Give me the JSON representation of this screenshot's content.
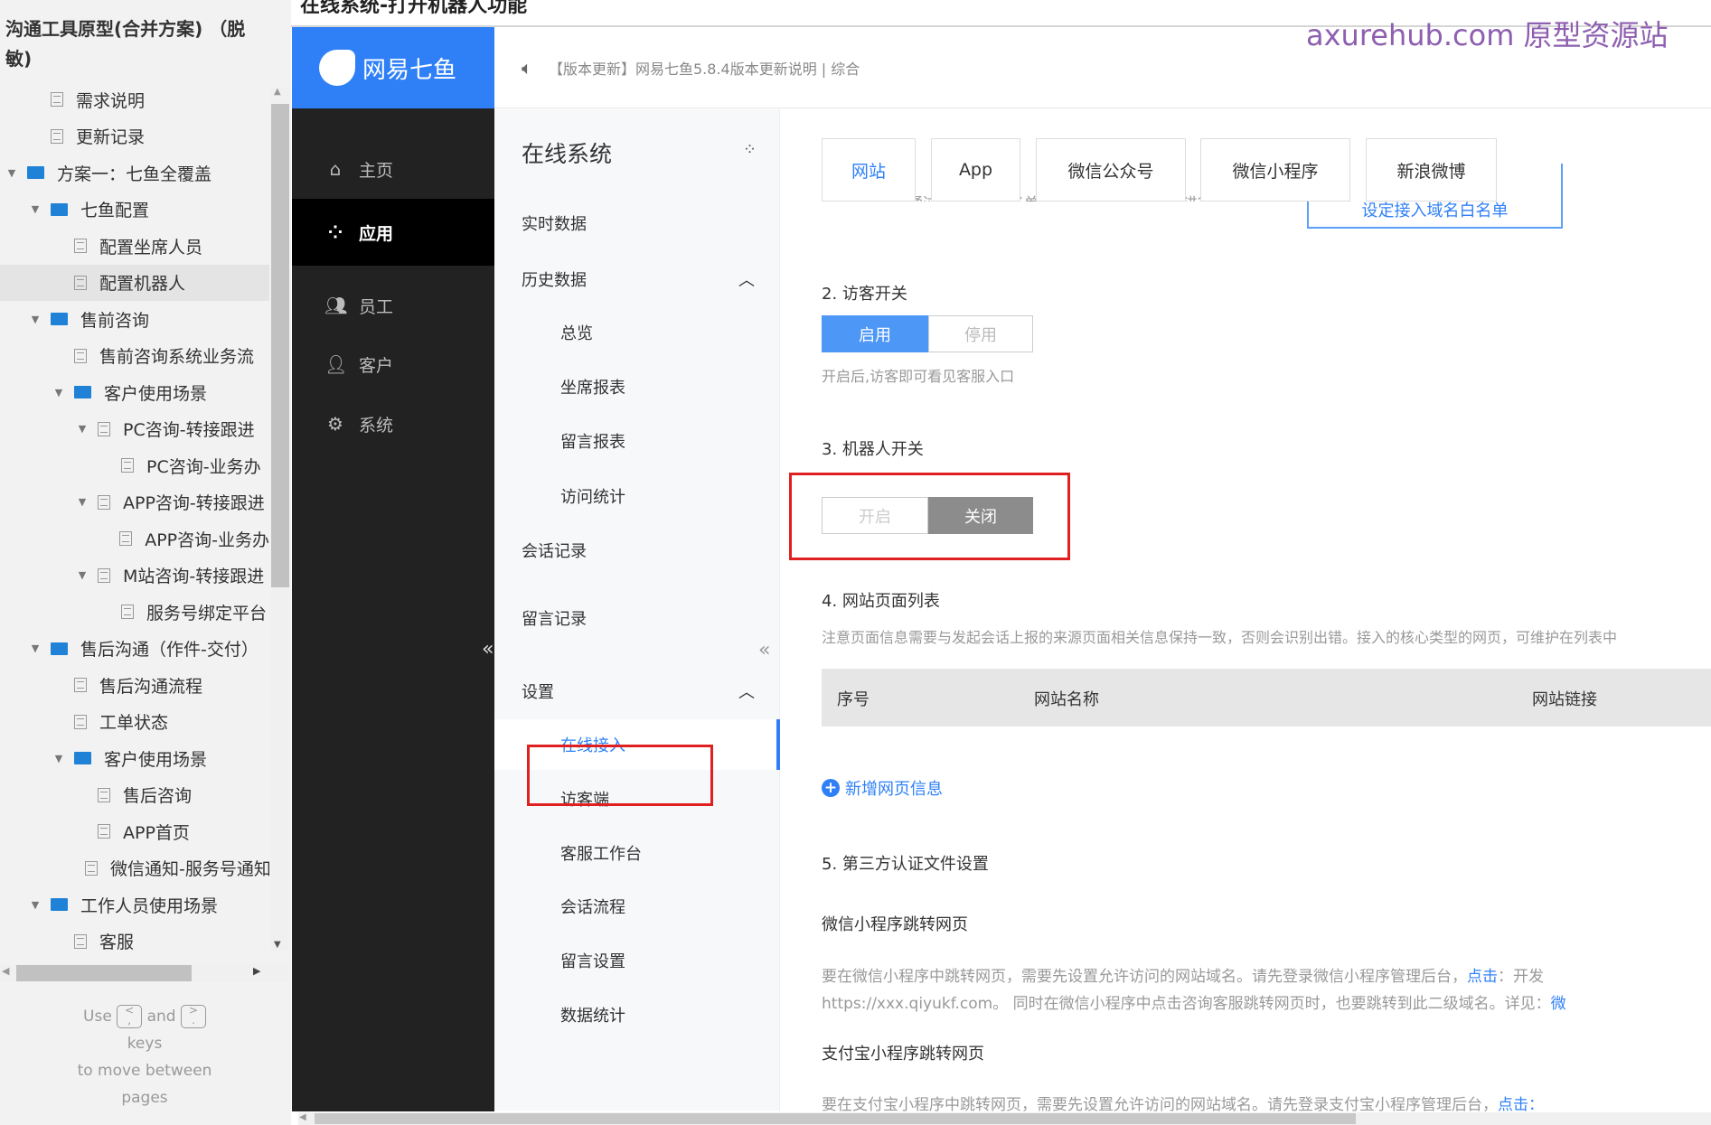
{
  "sidebar": {
    "title": "沟通工具原型(合并方案) （脱敏)",
    "items": [
      {
        "label": "需求说明",
        "type": "page",
        "level": 1,
        "expanded": false
      },
      {
        "label": "更新记录",
        "type": "page",
        "level": 1,
        "expanded": false
      },
      {
        "label": "方案一：七鱼全覆盖",
        "type": "folder",
        "level": 0,
        "expanded": true
      },
      {
        "label": "七鱼配置",
        "type": "folder",
        "level": 1,
        "expanded": true
      },
      {
        "label": "配置坐席人员",
        "type": "page",
        "level": 2
      },
      {
        "label": "配置机器人",
        "type": "page",
        "level": 2,
        "selected": true
      },
      {
        "label": "售前咨询",
        "type": "folder",
        "level": 1,
        "expanded": true
      },
      {
        "label": "售前咨询系统业务流",
        "type": "page",
        "level": 2
      },
      {
        "label": "客户使用场景",
        "type": "folder",
        "level": 2,
        "expanded": true
      },
      {
        "label": "PC咨询-转接跟进",
        "type": "page",
        "level": 3,
        "expanded": true
      },
      {
        "label": "PC咨询-业务办",
        "type": "page",
        "level": 4
      },
      {
        "label": "APP咨询-转接跟进",
        "type": "page",
        "level": 3,
        "expanded": true
      },
      {
        "label": "APP咨询-业务办",
        "type": "page",
        "level": 4
      },
      {
        "label": "M站咨询-转接跟进",
        "type": "page",
        "level": 3,
        "expanded": true
      },
      {
        "label": "服务号绑定平台",
        "type": "page",
        "level": 4
      },
      {
        "label": "售后沟通（作件-交付）",
        "type": "folder",
        "level": 1,
        "expanded": true
      },
      {
        "label": "售后沟通流程",
        "type": "page",
        "level": 2
      },
      {
        "label": "工单状态",
        "type": "page",
        "level": 2
      },
      {
        "label": "客户使用场景",
        "type": "folder",
        "level": 2,
        "expanded": true
      },
      {
        "label": "售后咨询",
        "type": "page",
        "level": 3
      },
      {
        "label": "APP首页",
        "type": "page",
        "level": 3
      },
      {
        "label": "微信通知-服务号通知",
        "type": "page",
        "level": 3
      },
      {
        "label": "工作人员使用场景",
        "type": "folder",
        "level": 1,
        "expanded": true
      },
      {
        "label": "客服",
        "type": "page",
        "level": 2
      }
    ],
    "hint": {
      "use": "Use",
      "key1": "<\n,",
      "and": "and",
      "key2": ">\n.",
      "keys": "keys",
      "rest1": "to move between",
      "rest2": "pages"
    }
  },
  "page_title": "在线系统-打开机器人功能",
  "watermark": "axurehub.com 原型资源站",
  "app": {
    "logo": "网易七鱼",
    "brand_color": "#2f80f7",
    "nav": [
      {
        "label": "主页",
        "icon": "home-icon"
      },
      {
        "label": "应用",
        "icon": "apps-icon",
        "active": true
      },
      {
        "label": "员工",
        "icon": "staff-icon"
      },
      {
        "label": "客户",
        "icon": "user-icon"
      },
      {
        "label": "系统",
        "icon": "gear-icon"
      }
    ],
    "announcement": "【版本更新】网易七鱼5.8.4版本更新说明 | 综合",
    "sub": {
      "title": "在线系统",
      "items": [
        {
          "label": "实时数据"
        },
        {
          "label": "历史数据",
          "group": true,
          "expanded": true
        },
        {
          "label": "总览",
          "child": true
        },
        {
          "label": "坐席报表",
          "child": true
        },
        {
          "label": "留言报表",
          "child": true
        },
        {
          "label": "访问统计",
          "child": true
        },
        {
          "label": "会话记录"
        },
        {
          "label": "留言记录"
        },
        {
          "label": "设置",
          "group": true,
          "expanded": true
        },
        {
          "label": "在线接入",
          "child": true,
          "active": true
        },
        {
          "label": "访客端",
          "child": true
        },
        {
          "label": "客服工作台",
          "child": true
        },
        {
          "label": "会话流程",
          "child": true
        },
        {
          "label": "留言设置",
          "child": true
        },
        {
          "label": "数据统计",
          "child": true
        }
      ]
    },
    "tabs": [
      {
        "label": "网站",
        "active": true
      },
      {
        "label": "App"
      },
      {
        "label": "微信公众号"
      },
      {
        "label": "微信小程序"
      },
      {
        "label": "新浪微博"
      }
    ],
    "clipped_note": "接入代码可以通过设定域名白名单，禁止非本企业的域名进行引用",
    "clipped_button": "设定接入域名白名单",
    "s2": {
      "title": "2.  访客开关",
      "on": "启用",
      "off": "停用",
      "note": "开启后,访客即可看见客服入口"
    },
    "s3": {
      "title": "3.  机器人开关",
      "on": "开启",
      "off": "关闭",
      "state": "off"
    },
    "s4": {
      "title": "4.  网站页面列表",
      "note": "注意页面信息需要与发起会话上报的来源页面相关信息保持一致，否则会识别出错。接入的核心类型的网页，可维护在列表中",
      "cols": [
        "序号",
        "网站名称",
        "网站链接"
      ],
      "add": "新增网页信息"
    },
    "s5": {
      "title": "5.  第三方认证文件设置",
      "wx_title": "微信小程序跳转网页",
      "wx_p1": "要在微信小程序中跳转网页，需要先设置允许访问的网站域名。请先登录微信小程序管理后台，",
      "wx_link1": "点击",
      "wx_p1b": "：开发",
      "wx_p2": "https://xxx.qiyukf.com。 同时在微信小程序中点击咨询客服跳转网页时，也要跳转到此二级域名。详见：",
      "wx_link2": "微",
      "ali_title": "支付宝小程序跳转网页",
      "ali_p1": "要在支付宝小程序中跳转网页，需要先设置允许访问的网站域名。请先登录支付宝小程序管理后台，",
      "ali_link1": "点击："
    }
  }
}
